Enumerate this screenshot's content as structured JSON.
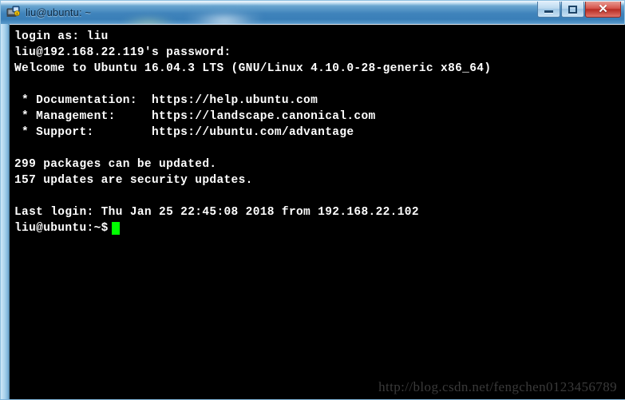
{
  "window": {
    "title": "liu@ubuntu: ~",
    "app_icon": "putty-icon",
    "controls": {
      "minimize_label": "–",
      "maximize_label": "□",
      "close_label": "✕"
    },
    "colors": {
      "frame": "#b9d9ef",
      "titlebar_blue": "#3f83bb",
      "close_red": "#b62c22",
      "terminal_bg": "#000000",
      "terminal_fg": "#ffffff",
      "cursor_green": "#00ff00"
    }
  },
  "terminal": {
    "lines": [
      "login as: liu",
      "liu@192.168.22.119's password:",
      "Welcome to Ubuntu 16.04.3 LTS (GNU/Linux 4.10.0-28-generic x86_64)",
      "",
      " * Documentation:  https://help.ubuntu.com",
      " * Management:     https://landscape.canonical.com",
      " * Support:        https://ubuntu.com/advantage",
      "",
      "299 packages can be updated.",
      "157 updates are security updates.",
      "",
      "Last login: Thu Jan 25 22:45:08 2018 from 192.168.22.102"
    ],
    "prompt": "liu@ubuntu:~$",
    "cursor": "block-cursor"
  },
  "watermark": {
    "text": "http://blog.csdn.net/fengchen0123456789"
  }
}
